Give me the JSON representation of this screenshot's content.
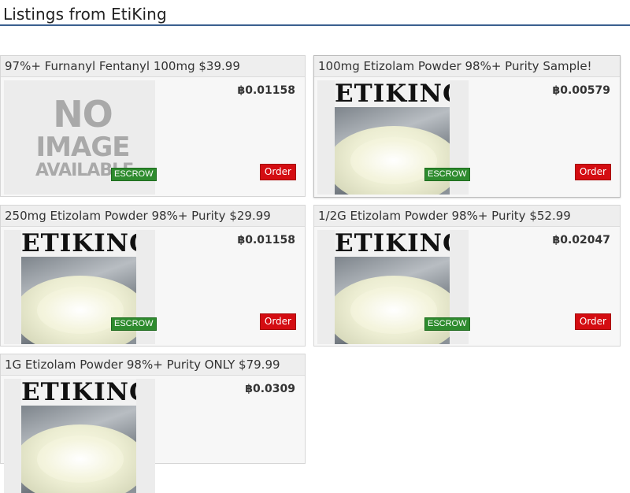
{
  "page": {
    "title": "Listings from EtiKing"
  },
  "listings": [
    {
      "title": "97%+ Furnanyl Fentanyl 100mg $39.99",
      "price": "฿0.01158",
      "badge": "ESCROW",
      "order_label": "Order",
      "image": "no-image",
      "no_image_text": [
        "NO",
        "IMAGE",
        "AVAILABLE"
      ]
    },
    {
      "title": "100mg Etizolam Powder 98%+ Purity Sample!",
      "price": "฿0.00579",
      "badge": "ESCROW",
      "order_label": "Order",
      "image": "product-photo",
      "brand_text": "ETIKING"
    },
    {
      "title": "250mg Etizolam Powder 98%+ Purity $29.99",
      "price": "฿0.01158",
      "badge": "ESCROW",
      "order_label": "Order",
      "image": "product-photo",
      "brand_text": "ETIKING"
    },
    {
      "title": "1/2G Etizolam Powder 98%+ Purity $52.99",
      "price": "฿0.02047",
      "badge": "ESCROW",
      "order_label": "Order",
      "image": "product-photo",
      "brand_text": "ETIKING"
    },
    {
      "title": "1G Etizolam Powder 98%+ Purity ONLY $79.99",
      "price": "฿0.0309",
      "image": "product-photo",
      "brand_text": "ETIKING"
    }
  ],
  "colors": {
    "header_rule": "#3a5f8f",
    "escrow_badge": "#2e8b2e",
    "order_button": "#d40d12",
    "card_bg": "#f7f7f7",
    "card_title_bg": "#eeeeee"
  }
}
